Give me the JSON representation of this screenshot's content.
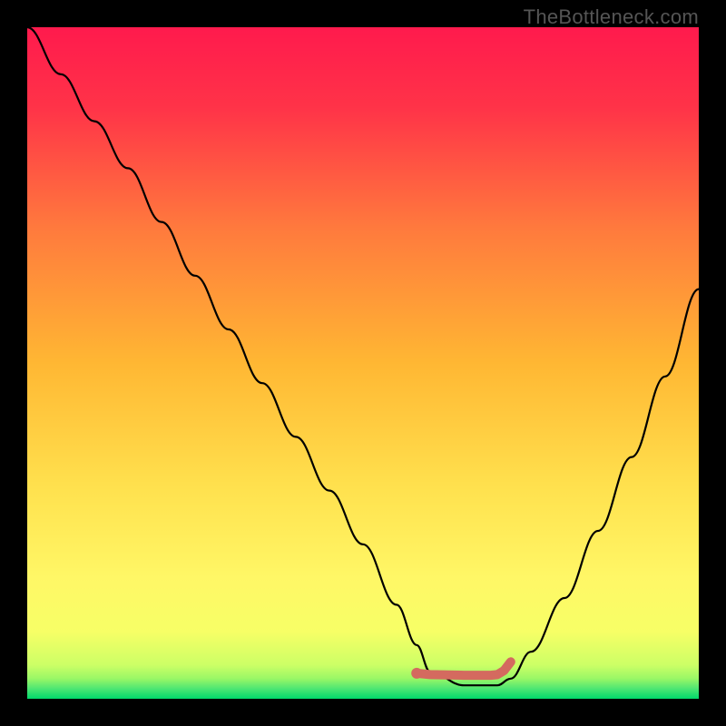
{
  "watermark": "TheBottleneck.com",
  "chart_data": {
    "type": "line",
    "title": "",
    "xlabel": "",
    "ylabel": "",
    "xlim": [
      0,
      100
    ],
    "ylim": [
      0,
      100
    ],
    "grid": false,
    "background_gradient": {
      "top_color": "#ff1a4d",
      "mid_color": "#ffd633",
      "low_color": "#ffff66",
      "bottom_color": "#00e673"
    },
    "series": [
      {
        "name": "curve",
        "color": "#000000",
        "x": [
          0,
          5,
          10,
          15,
          20,
          25,
          30,
          35,
          40,
          45,
          50,
          55,
          58,
          60,
          65,
          70,
          72,
          75,
          80,
          85,
          90,
          95,
          100
        ],
        "y": [
          100,
          93,
          86,
          79,
          71,
          63,
          55,
          47,
          39,
          31,
          23,
          14,
          8,
          4,
          2,
          2,
          3,
          7,
          15,
          25,
          36,
          48,
          61
        ]
      },
      {
        "name": "optimal-marker",
        "color": "#d46a5f",
        "type": "marker-path",
        "x": [
          58,
          60,
          65,
          69,
          70,
          71,
          72
        ],
        "y": [
          3.8,
          3.6,
          3.5,
          3.5,
          3.6,
          4.2,
          5.5
        ]
      }
    ],
    "annotations": []
  }
}
